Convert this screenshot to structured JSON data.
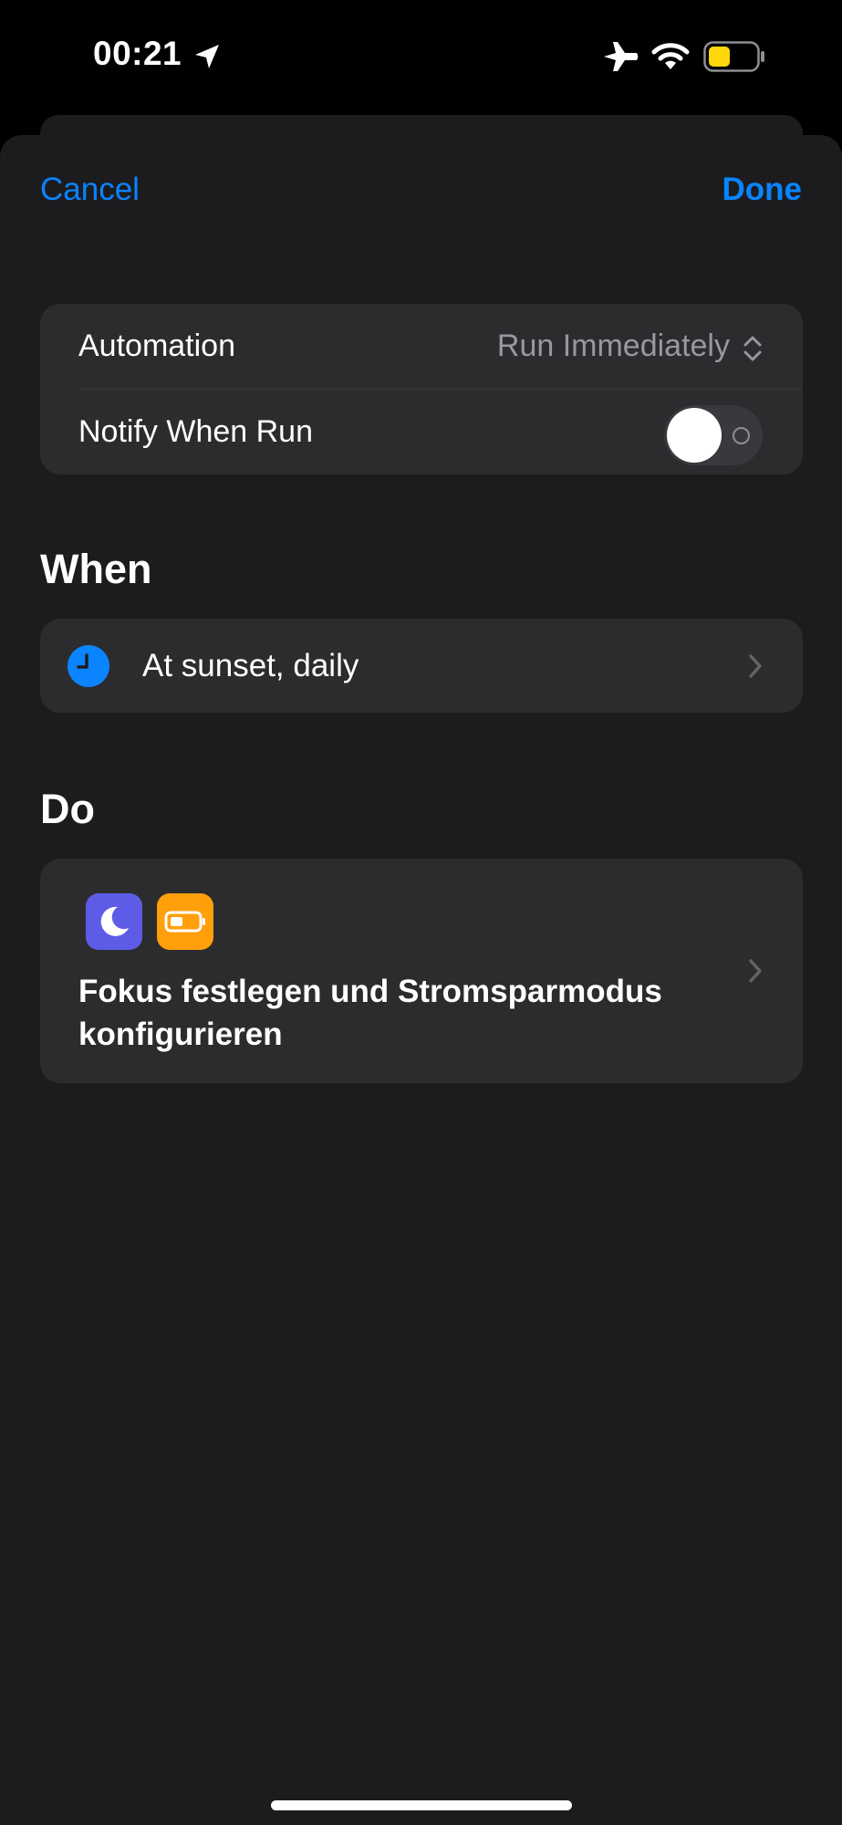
{
  "status_bar": {
    "time": "00:21",
    "icons": [
      "location-arrow-icon",
      "airplane-mode-icon",
      "wifi-icon",
      "battery-icon"
    ],
    "battery_color": "#ffd60a"
  },
  "nav": {
    "cancel_label": "Cancel",
    "done_label": "Done",
    "accent_color": "#0a84ff"
  },
  "settings": {
    "automation_label": "Automation",
    "automation_value": "Run Immediately",
    "notify_label": "Notify When Run",
    "notify_enabled": false
  },
  "when": {
    "section_title": "When",
    "trigger_text": "At sunset, daily",
    "trigger_icon": "clock-icon"
  },
  "do": {
    "section_title": "Do",
    "action_icons": [
      "focus-moon-icon",
      "low-power-battery-icon"
    ],
    "action_text": "Fokus festlegen und Stromsparmodus konfigurieren"
  }
}
